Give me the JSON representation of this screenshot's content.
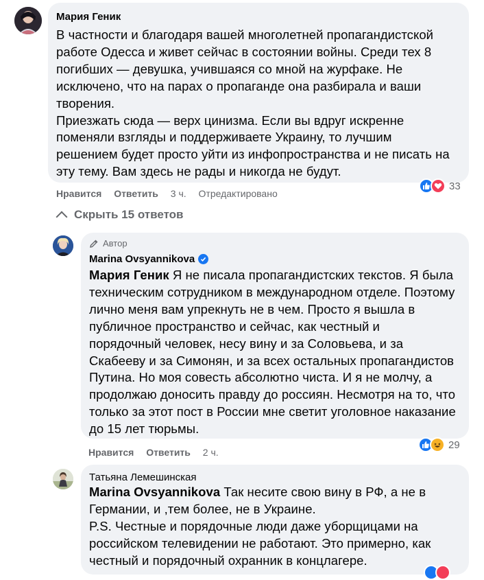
{
  "comments": [
    {
      "author": "Мария Геник",
      "lines": [
        "В частности и благодаря вашей многолетней пропагандистской",
        "работе Одесса и живет сейчас в состоянии войны. Среди тех 8",
        "погибших — девушка, учившаяся со мной на журфаке. Не",
        "исключено, что на парах о пропаганде она разбирала и ваши",
        "творения.",
        "Приезжать сюда — верх цинизма. Если вы вдруг искренне",
        "поменяли взгляды и поддерживаете Украину, то лучшим",
        "решением будет просто уйти из инфопространства и не писать на",
        "эту тему. Вам здесь не рады и никогда не будут."
      ],
      "like_label": "Нравится",
      "reply_label": "Ответить",
      "time": "3 ч.",
      "edited": "Отредактировано",
      "reaction_count": "33",
      "reaction_icons": [
        "like-icon",
        "love-icon"
      ]
    },
    {
      "badge": "Автор",
      "author": "Marina Ovsyannikova",
      "verified": true,
      "mention": "Мария Геник",
      "first_line_rest": " Я не писала пропагандистских текстов. Я была",
      "lines": [
        "техническим сотрудником в международном отделе. Поэтому",
        "лично меня вам упрекнуть не в чем. Просто я вышла в",
        "публичное пространство и сейчас, как честный и",
        "порядочный человек, несу вину и за Соловьева, и за",
        "Скабееву и за Симонян, и за всех остальных пропагандистов",
        "Путина. Но моя совесть абсолютно чиста. И я не молчу, а",
        "продолжаю доносить правду до россиян. Несмотря на то, что",
        "только за этот пост в России мне светит уголовное наказание",
        "до 15 лет тюрьмы."
      ],
      "like_label": "Нравится",
      "reply_label": "Ответить",
      "time": "2 ч.",
      "reaction_count": "29",
      "reaction_icons": [
        "like-icon",
        "haha-icon"
      ]
    },
    {
      "author": "Татьяна Лемешинская",
      "mention": "Marina Ovsyannikova",
      "first_line_rest": " Так несите свою вину в РФ, а не в",
      "lines": [
        "Германии, и ,тем более, не в Украине.",
        "P.S. Честные и порядочные люди даже уборщицами на",
        "российском телевидении не работают. Это примерно, как",
        "честный и порядочный охранник в концлагере."
      ]
    }
  ],
  "toggle_replies": "Скрыть 15 ответов",
  "colors": {
    "bubble": "#f0f2f5",
    "secondary": "#65676b",
    "like": "#1877f2",
    "love": "#f33e58",
    "haha": "#f7b125"
  }
}
